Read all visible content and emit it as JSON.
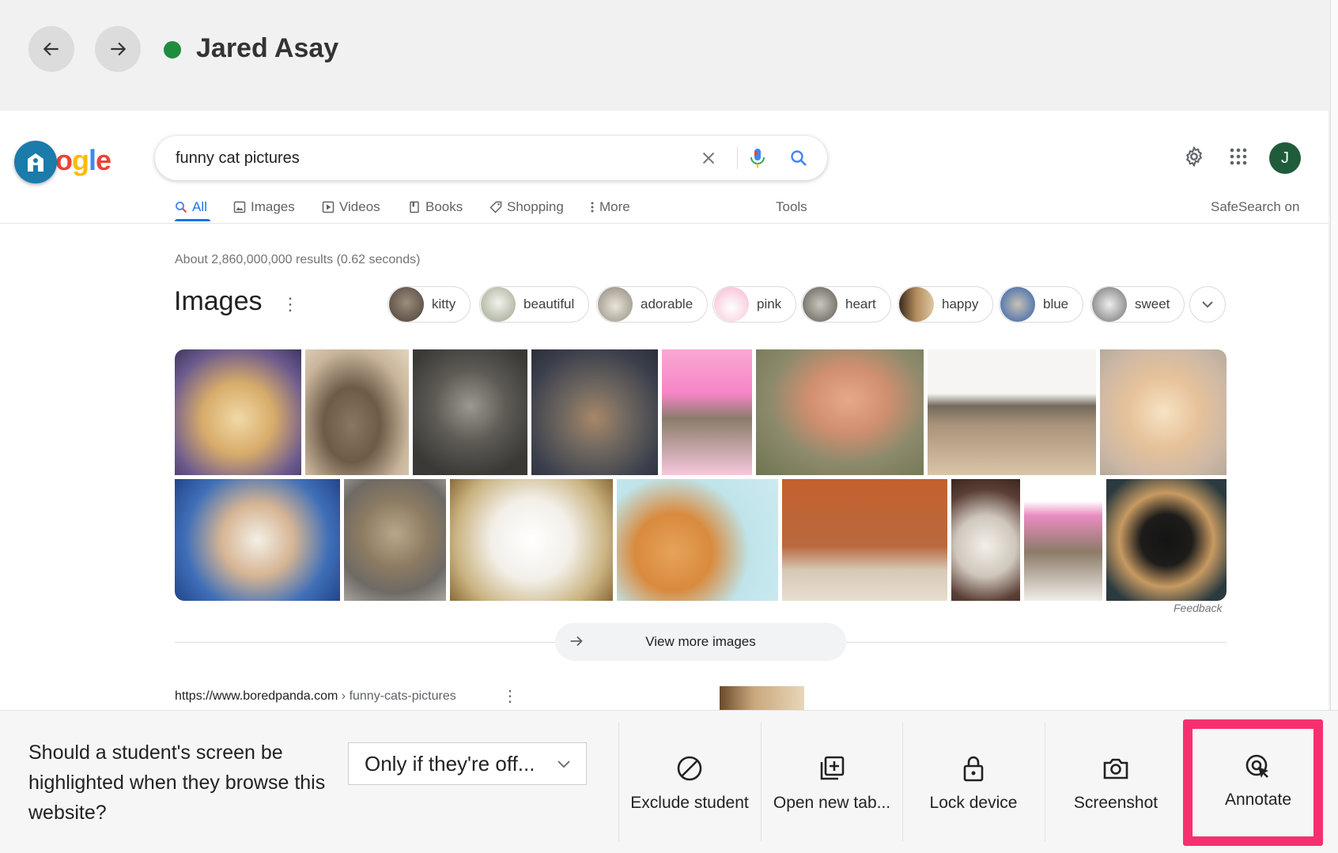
{
  "header": {
    "student_name": "Jared Asay",
    "status_color": "#1e8e3e"
  },
  "google": {
    "logo_partial": "ogle",
    "search_query": "funny cat pictures",
    "avatar_letter": "J",
    "tabs": [
      {
        "label": "All",
        "icon": "search-icon",
        "active": true
      },
      {
        "label": "Images",
        "icon": "image-icon"
      },
      {
        "label": "Videos",
        "icon": "play-icon"
      },
      {
        "label": "Books",
        "icon": "book-icon"
      },
      {
        "label": "Shopping",
        "icon": "tag-icon"
      },
      {
        "label": "More",
        "icon": "more-vert-icon"
      }
    ],
    "tools_label": "Tools",
    "safesearch_label": "SafeSearch on",
    "result_stats": "About 2,860,000,000 results (0.62 seconds)",
    "images_title": "Images",
    "chips": [
      "kitty",
      "beautiful",
      "adorable",
      "pink",
      "heart",
      "happy",
      "blue",
      "sweet"
    ],
    "feedback_label": "Feedback",
    "view_more_label": "View more images",
    "result_url_domain": "https://www.boredpanda.com",
    "result_url_path": " › funny-cats-pictures",
    "brand_colors": {
      "blue": "#4285f4",
      "red": "#ea4335",
      "yellow": "#fbbc05",
      "green": "#34a853"
    }
  },
  "controls": {
    "question": "Should a student's screen be highlighted when they browse this website?",
    "dropdown_value": "Only if they're off...",
    "actions": [
      {
        "label": "Exclude student",
        "icon": "block-icon"
      },
      {
        "label": "Open new tab...",
        "icon": "add-tab-icon"
      },
      {
        "label": "Lock device",
        "icon": "lock-icon"
      },
      {
        "label": "Screenshot",
        "icon": "camera-icon"
      },
      {
        "label": "Annotate",
        "icon": "annotate-icon"
      }
    ],
    "highlight_color": "#f6306e"
  }
}
